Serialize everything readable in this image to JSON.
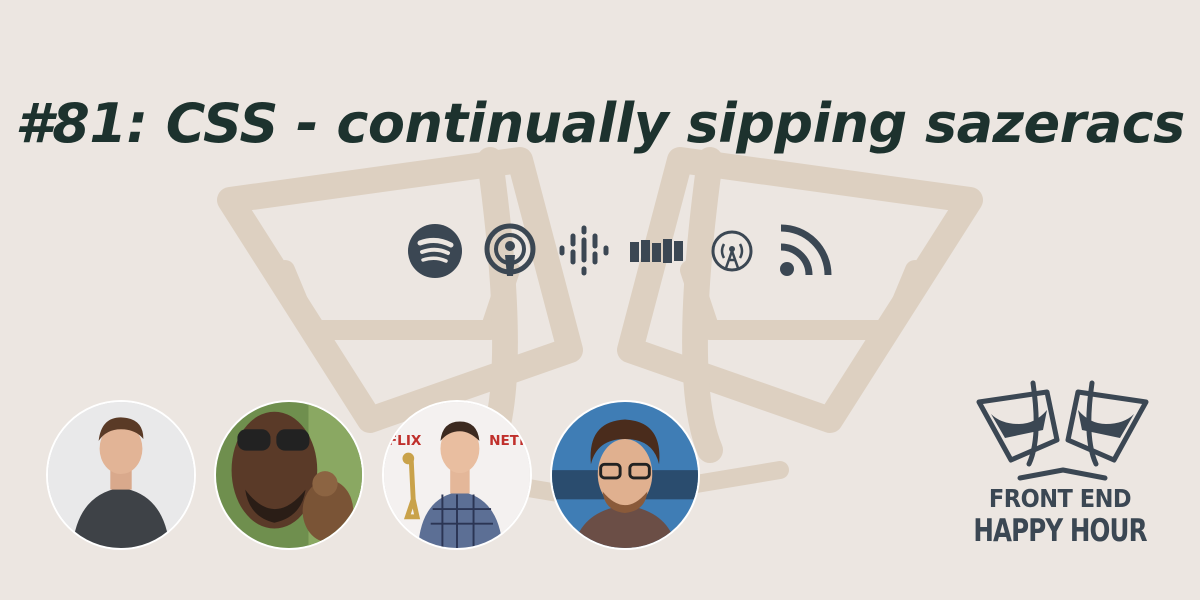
{
  "episode": {
    "title": "#81: CSS - continually sipping sazeracs"
  },
  "platforms": [
    {
      "icon": "spotify-icon"
    },
    {
      "icon": "apple-podcasts-icon"
    },
    {
      "icon": "google-podcasts-icon"
    },
    {
      "icon": "stitcher-icon"
    },
    {
      "icon": "overcast-icon"
    },
    {
      "icon": "rss-feed-icon"
    }
  ],
  "hosts": [
    {
      "icon": "host-photo-1"
    },
    {
      "icon": "host-photo-2"
    },
    {
      "icon": "host-photo-3"
    },
    {
      "icon": "host-photo-4"
    }
  ],
  "brand": {
    "line1": "FRONT END",
    "line2": "HAPPY HOUR"
  },
  "colors": {
    "background": "#ece6e1",
    "title": "#1d322e",
    "icons": "#3b4753",
    "watermark": "#ddd0c1"
  }
}
